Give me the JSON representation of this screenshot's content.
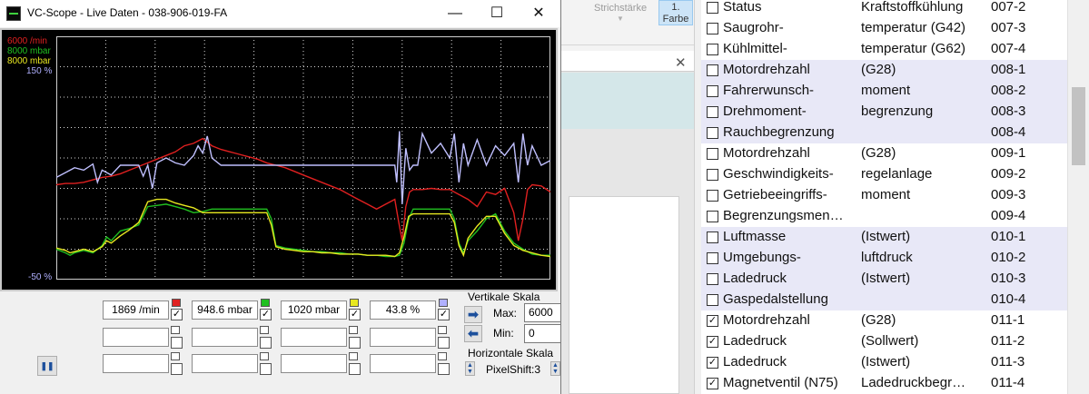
{
  "background_app": {
    "ribbon_label": "Strichstärke",
    "color_button": "1. Farbe",
    "close_glyph": "✕"
  },
  "scope": {
    "title": "VC-Scope  -  Live Daten  -  038-906-019-FA",
    "axis_labels": [
      {
        "text": "6000 /min",
        "color": "#e02020"
      },
      {
        "text": "8000 mbar",
        "color": "#20c020"
      },
      {
        "text": "8000 mbar",
        "color": "#e8e820"
      },
      {
        "text": "150 %",
        "color": "#b0b0ff"
      }
    ],
    "y_min_label": "-50 %",
    "channels": [
      {
        "value": "1869 /min",
        "color": "#e02020",
        "checked": true
      },
      {
        "value": "948.6 mbar",
        "color": "#20c020",
        "checked": true
      },
      {
        "value": "1020 mbar",
        "color": "#e8e820",
        "checked": true
      },
      {
        "value": "43.8 %",
        "color": "#b0b0ff",
        "checked": true
      }
    ],
    "vertical_scale": {
      "title": "Vertikale Skala",
      "max_label": "Max:",
      "max_value": "6000",
      "min_label": "Min:",
      "min_value": "0"
    },
    "horizontal_scale": {
      "title": "Horizontale Skala",
      "value": "PixelShift:3"
    }
  },
  "chart_data": {
    "type": "line",
    "y_range_percent": [
      -50,
      150
    ],
    "grid": true,
    "series": [
      {
        "name": "6000 /min",
        "color": "#e02020",
        "x": [
          0,
          10,
          20,
          30,
          40,
          50,
          60,
          70,
          80,
          90,
          100,
          110,
          120,
          130,
          140,
          150,
          160,
          170,
          180,
          190,
          200,
          210,
          220,
          230,
          240,
          250,
          260,
          270,
          280,
          290,
          300,
          310,
          320,
          330,
          340,
          350,
          360,
          370,
          374,
          378,
          382,
          386,
          390,
          400,
          410,
          420,
          430,
          440,
          450,
          460,
          470,
          480,
          490,
          500,
          505,
          510,
          515,
          520,
          530,
          540
        ],
        "y": [
          28,
          29,
          29,
          30,
          32,
          34,
          35,
          37,
          40,
          43,
          46,
          49,
          52,
          55,
          60,
          62,
          66,
          60,
          57,
          55,
          53,
          51,
          49,
          46,
          44,
          42,
          39,
          36,
          33,
          30,
          27,
          24,
          20,
          16,
          12,
          8,
          12,
          16,
          -2,
          -18,
          10,
          22,
          24,
          24,
          25,
          24,
          24,
          20,
          16,
          10,
          22,
          20,
          25,
          5,
          -18,
          0,
          24,
          28,
          27,
          22
        ]
      },
      {
        "name": "8000 mbar",
        "color": "#20c020",
        "x": [
          0,
          10,
          15,
          20,
          30,
          40,
          50,
          55,
          60,
          70,
          80,
          90,
          100,
          110,
          120,
          130,
          140,
          150,
          160,
          170,
          180,
          190,
          200,
          210,
          220,
          230,
          235,
          240,
          250,
          260,
          270,
          280,
          290,
          300,
          310,
          320,
          330,
          340,
          350,
          360,
          370,
          375,
          380,
          385,
          390,
          400,
          410,
          420,
          430,
          435,
          440,
          445,
          450,
          460,
          470,
          480,
          490,
          500,
          510,
          520,
          530,
          540
        ],
        "y": [
          -25,
          -28,
          -30,
          -28,
          -26,
          -28,
          -22,
          -15,
          -18,
          -10,
          -8,
          -5,
          10,
          11,
          12,
          10,
          8,
          5,
          6,
          8,
          8,
          8,
          8,
          8,
          8,
          8,
          0,
          -22,
          -24,
          -25,
          -26,
          -27,
          -27,
          -28,
          -28,
          -29,
          -29,
          -30,
          -30,
          -31,
          -31,
          -30,
          -20,
          0,
          8,
          8,
          8,
          8,
          8,
          0,
          -20,
          -28,
          -18,
          -10,
          0,
          4,
          -10,
          -20,
          -25,
          -29,
          -30,
          -30
        ]
      },
      {
        "name": "8000 mbar",
        "color": "#e8e820",
        "x": [
          0,
          10,
          15,
          20,
          30,
          40,
          50,
          55,
          60,
          70,
          80,
          90,
          100,
          110,
          120,
          130,
          140,
          150,
          160,
          170,
          180,
          190,
          200,
          210,
          220,
          230,
          235,
          240,
          250,
          260,
          270,
          280,
          290,
          300,
          310,
          320,
          330,
          340,
          350,
          360,
          370,
          375,
          380,
          385,
          390,
          400,
          410,
          420,
          430,
          435,
          440,
          445,
          450,
          460,
          470,
          480,
          490,
          500,
          510,
          520,
          530,
          540
        ],
        "y": [
          -24,
          -26,
          -28,
          -27,
          -25,
          -27,
          -23,
          -18,
          -20,
          -14,
          -9,
          -3,
          14,
          16,
          16,
          13,
          11,
          9,
          5,
          5,
          5,
          5,
          5,
          5,
          5,
          5,
          -5,
          -23,
          -25,
          -26,
          -27,
          -27,
          -28,
          -28,
          -29,
          -29,
          -29,
          -30,
          -30,
          -30,
          -31,
          -28,
          -15,
          2,
          4,
          4,
          4,
          4,
          4,
          -3,
          -22,
          -30,
          -16,
          -6,
          2,
          2,
          -12,
          -22,
          -26,
          -28,
          -30,
          -31
        ]
      },
      {
        "name": "150 %",
        "color": "#c0c0ff",
        "x": [
          0,
          10,
          20,
          30,
          40,
          45,
          50,
          60,
          70,
          80,
          90,
          95,
          100,
          105,
          110,
          120,
          130,
          140,
          150,
          155,
          160,
          165,
          170,
          180,
          190,
          200,
          210,
          220,
          230,
          240,
          250,
          260,
          270,
          280,
          290,
          300,
          310,
          320,
          330,
          340,
          350,
          360,
          370,
          372,
          375,
          378,
          382,
          386,
          390,
          395,
          400,
          410,
          420,
          430,
          435,
          440,
          445,
          450,
          460,
          470,
          480,
          490,
          500,
          505,
          510,
          515,
          520,
          530,
          540
        ],
        "y": [
          34,
          38,
          42,
          40,
          45,
          30,
          40,
          36,
          44,
          44,
          44,
          35,
          44,
          25,
          46,
          50,
          46,
          44,
          52,
          60,
          54,
          68,
          50,
          44,
          44,
          44,
          44,
          44,
          44,
          44,
          44,
          44,
          44,
          44,
          44,
          44,
          44,
          44,
          44,
          44,
          44,
          44,
          44,
          30,
          72,
          12,
          58,
          40,
          44,
          44,
          70,
          54,
          62,
          50,
          70,
          30,
          62,
          44,
          65,
          44,
          60,
          52,
          62,
          30,
          70,
          44,
          60,
          44,
          48
        ]
      }
    ]
  },
  "list": {
    "rows": [
      {
        "name": "Status",
        "desc": "Kraftstoffkühlung",
        "code": "007-2",
        "checked": false,
        "alt": false
      },
      {
        "name": "Saugrohr-",
        "desc": "temperatur (G42)",
        "code": "007-3",
        "checked": false,
        "alt": false
      },
      {
        "name": "Kühlmittel-",
        "desc": "temperatur (G62)",
        "code": "007-4",
        "checked": false,
        "alt": false
      },
      {
        "name": "Motordrehzahl",
        "desc": "(G28)",
        "code": "008-1",
        "checked": false,
        "alt": true
      },
      {
        "name": "Fahrerwunsch-",
        "desc": "moment",
        "code": "008-2",
        "checked": false,
        "alt": true
      },
      {
        "name": "Drehmoment-",
        "desc": "begrenzung",
        "code": "008-3",
        "checked": false,
        "alt": true
      },
      {
        "name": "Rauchbegrenzung",
        "desc": "",
        "code": "008-4",
        "checked": false,
        "alt": true
      },
      {
        "name": "Motordrehzahl",
        "desc": "(G28)",
        "code": "009-1",
        "checked": false,
        "alt": false
      },
      {
        "name": "Geschwindigkeits-",
        "desc": "regelanlage",
        "code": "009-2",
        "checked": false,
        "alt": false
      },
      {
        "name": "Getriebeeingriffs-",
        "desc": "moment",
        "code": "009-3",
        "checked": false,
        "alt": false
      },
      {
        "name": "Begrenzungsmen…",
        "desc": "",
        "code": "009-4",
        "checked": false,
        "alt": false
      },
      {
        "name": "Luftmasse",
        "desc": "(Istwert)",
        "code": "010-1",
        "checked": false,
        "alt": true
      },
      {
        "name": "Umgebungs-",
        "desc": "luftdruck",
        "code": "010-2",
        "checked": false,
        "alt": true
      },
      {
        "name": "Ladedruck",
        "desc": "(Istwert)",
        "code": "010-3",
        "checked": false,
        "alt": true
      },
      {
        "name": "Gaspedalstellung",
        "desc": "",
        "code": "010-4",
        "checked": false,
        "alt": true
      },
      {
        "name": "Motordrehzahl",
        "desc": "(G28)",
        "code": "011-1",
        "checked": true,
        "alt": false
      },
      {
        "name": "Ladedruck",
        "desc": "(Sollwert)",
        "code": "011-2",
        "checked": true,
        "alt": false
      },
      {
        "name": "Ladedruck",
        "desc": "(Istwert)",
        "code": "011-3",
        "checked": true,
        "alt": false
      },
      {
        "name": "Magnetventil (N75)",
        "desc": "Ladedruckbegr…",
        "code": "011-4",
        "checked": true,
        "alt": false
      }
    ]
  }
}
